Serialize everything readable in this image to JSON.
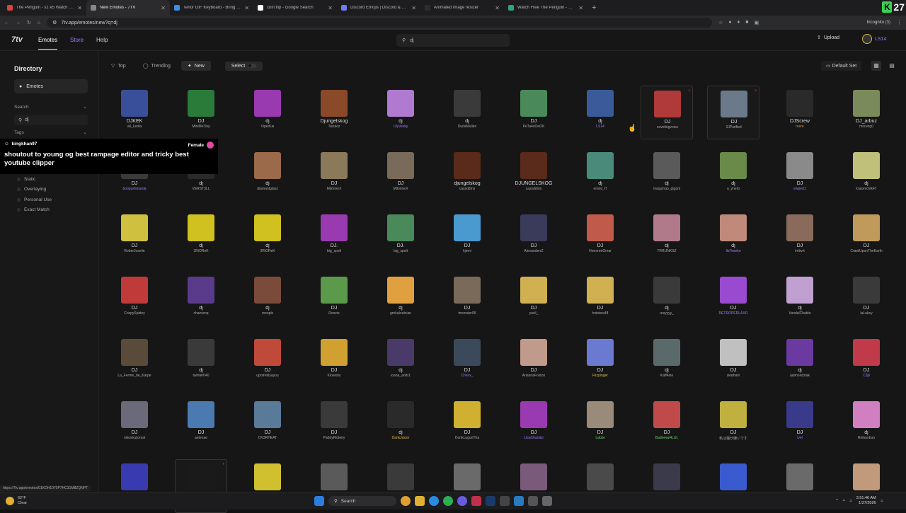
{
  "browser": {
    "tabs": [
      {
        "title": "The Penguin - s1 e5 Watch Fre",
        "color": "#d6463f",
        "active": false
      },
      {
        "title": "New Emotes - 7TV",
        "color": "#888888",
        "active": true
      },
      {
        "title": "Tenor GIF Keyboard - Bring Per",
        "color": "#3a8ee6",
        "active": false
      },
      {
        "title": "coin flip - Google Search",
        "color": "#ffffff",
        "active": false
      },
      {
        "title": "Discord Emojis | Discord & Slac",
        "color": "#6f7cf3",
        "active": false
      },
      {
        "title": "Animated image resizer",
        "color": "#2d2d2d",
        "active": false
      },
      {
        "title": "Watch Free The Penguin - Seas",
        "color": "#2fa37a",
        "active": false
      }
    ],
    "new_tab": "+",
    "url": "7tv.app/emotes/new?q=dj",
    "incognito": "Incognito (3)",
    "kick_count": "27",
    "kick_letter": "K",
    "status_url": "https://7tv.app/emotes/01KDH1070P7HC31M8ZQNPT"
  },
  "nav": {
    "logo": "7tv",
    "emotes": "Emotes",
    "store": "Store",
    "help": "Help",
    "search_value": "dj",
    "upload": "Upload",
    "username": "LS14"
  },
  "sidebar": {
    "title": "Directory",
    "emotes": "Emotes",
    "search_label": "Search",
    "search_value": "dj",
    "tags_label": "Tags",
    "filters": [
      "Static",
      "Overlaying",
      "Personal Use",
      "Exact Match"
    ]
  },
  "toolbar": {
    "top": "Top",
    "trending": "Trending",
    "new": "New",
    "select": "Select",
    "default_set": "Default Set"
  },
  "toast": {
    "user": "kingkhan97",
    "gender": "Female",
    "message": "shoutout to young og best rampage editor and tricky best youtube clipper"
  },
  "emotes": [
    [
      {
        "n": "DJKEK",
        "o": "a6_lunita",
        "c": "#3a4f9a"
      },
      {
        "n": "DJ",
        "o": "MiniMeTiny",
        "c": "#2a7a3a"
      },
      {
        "n": "dj",
        "o": "ViperKai",
        "c": "#9a3ab0"
      },
      {
        "n": "Djungelskog",
        "o": "Tazukiz",
        "c": "#8a4a2a"
      },
      {
        "n": "dj",
        "o": "LilyVesky",
        "oc": "p",
        "c": "#b07ad0"
      },
      {
        "n": "dj",
        "o": "DudaMullen",
        "c": "#3a3a3a"
      },
      {
        "n": "DJ",
        "o": "PeTa4oOeOK",
        "c": "#4a8a5a"
      },
      {
        "n": "dj",
        "o": "LS14",
        "oc": "p",
        "c": "#3a5a9a"
      },
      {
        "n": "DJ",
        "o": "covetingvoice",
        "c": "#b03a3a",
        "b": true
      },
      {
        "n": "DJ",
        "o": "ElPurified",
        "c": "#6a7a8a",
        "b": true
      },
      {
        "n": "DJScrew",
        "o": "roxre",
        "oc": "o",
        "c": "#2a2a2a"
      },
      {
        "n": "DJ_arbuz",
        "o": "morung0",
        "c": "#7a8a5a"
      }
    ],
    [
      {
        "n": "DJ",
        "o": "boopyshmurda",
        "oc": "p",
        "c": "#3a3a3a"
      },
      {
        "n": "dj",
        "o": "VERST3LL",
        "c": "#2a2a2a"
      },
      {
        "n": "dj",
        "o": "diamantglass",
        "c": "#9a6a4a"
      },
      {
        "n": "DJ",
        "o": "MilonneX",
        "c": "#8a7a5a"
      },
      {
        "n": "DJ",
        "o": "MilonneX",
        "c": "#7a6a5a"
      },
      {
        "n": "djungelskog",
        "o": "cassddms",
        "c": "#5a2a1a"
      },
      {
        "n": "DJUNGELSKOG",
        "o": "cassddms",
        "c": "#5a2a1a"
      },
      {
        "n": "dj",
        "o": "emire_H",
        "c": "#4a8a7a"
      },
      {
        "n": "dj",
        "o": "maquinao_gigant",
        "c": "#5a5a5a"
      },
      {
        "n": "dj",
        "o": "o_ynerb",
        "c": "#6a8a4a"
      },
      {
        "n": "DJ",
        "o": "ewpert1",
        "oc": "p",
        "c": "#8a8a8a"
      },
      {
        "n": "dj",
        "o": "krasevchik47",
        "c": "#c0c07a"
      }
    ],
    [
      {
        "n": "DJ",
        "o": "RoberJoselin",
        "c": "#d0c040"
      },
      {
        "n": "dj",
        "o": "3RiOReK",
        "c": "#d0c020"
      },
      {
        "n": "dj",
        "o": "3RiOReK",
        "c": "#d0c020"
      },
      {
        "n": "DJ.",
        "o": "big_spolt",
        "c": "#9a3ab0"
      },
      {
        "n": "DJ.",
        "o": "big_spolt",
        "c": "#4a8a5a"
      },
      {
        "n": "DJ",
        "o": "kjemi",
        "c": "#4a9ad0"
      },
      {
        "n": "DJ",
        "o": "AlexanderrZ",
        "c": "#3a3a5a"
      },
      {
        "n": "DJ",
        "o": "HonoredOmar",
        "c": "#c05a4a"
      },
      {
        "n": "dj",
        "o": "TRRUNKSZ",
        "c": "#b07a8a"
      },
      {
        "n": "dj",
        "o": "ItzTeseko",
        "oc": "p",
        "c": "#c08a7a"
      },
      {
        "n": "DJ",
        "o": "imbvrt",
        "c": "#8a6a5a"
      },
      {
        "n": "DJ",
        "o": "CrawlUponTheEarth",
        "c": "#c09a5a"
      }
    ],
    [
      {
        "n": "DJ",
        "o": "CrispySpidey",
        "c": "#c03a3a"
      },
      {
        "n": "dj",
        "o": "chazzzop",
        "c": "#5a3a8a"
      },
      {
        "n": "dj",
        "o": "roxopls",
        "c": "#7a4a3a"
      },
      {
        "n": "DJ",
        "o": "Roozie",
        "c": "#5a9a4a"
      },
      {
        "n": "dj",
        "o": "grekukralnian",
        "c": "#e0a040"
      },
      {
        "n": "DJ",
        "o": "tmonster95",
        "c": "#7a6a5a"
      },
      {
        "n": "DJ",
        "o": "yavil_",
        "c": "#d0b050"
      },
      {
        "n": "DJ",
        "o": "hotstew48",
        "c": "#d0b050"
      },
      {
        "n": "dj",
        "o": "rexyyyy_",
        "c": "#3a3a3a"
      },
      {
        "n": "DJ",
        "o": "RETROPERLAXO",
        "oc": "p",
        "c": "#9a4ad0"
      },
      {
        "n": "dj",
        "o": "VandalChatito",
        "c": "#c0a0d0"
      },
      {
        "n": "DJ",
        "o": "laLakey",
        "c": "#3a3a3a"
      }
    ],
    [
      {
        "n": "DJ",
        "o": "La_Ferme_de_Karpe",
        "c": "#5a4a3a"
      },
      {
        "n": "dj",
        "o": "twinter040",
        "c": "#3a3a3a"
      },
      {
        "n": "DJ",
        "o": "upotreblyayou",
        "c": "#c04a3a"
      },
      {
        "n": "DJ",
        "o": "Kloveslu",
        "c": "#d0a030"
      },
      {
        "n": "dj",
        "o": "ioana_andr1",
        "c": "#4a3a6a"
      },
      {
        "n": "DJ",
        "o": "Chevx_",
        "oc": "p",
        "c": "#3a4a5a"
      },
      {
        "n": "DJ",
        "o": "AriannaFoxton",
        "c": "#c09a8a"
      },
      {
        "n": "DJ",
        "o": "Fitzpinger",
        "oc": "y",
        "c": "#6a7ad0"
      },
      {
        "n": "dj",
        "o": "Kaff4ine",
        "c": "#5a6a6a"
      },
      {
        "n": "DJ",
        "o": "skathain",
        "c": "#c0c0c0"
      },
      {
        "n": "dj",
        "o": "aalmondziak",
        "c": "#6a3aa0"
      },
      {
        "n": "DJ",
        "o": "C3jii",
        "oc": "p",
        "c": "#c03a4a"
      }
    ],
    [
      {
        "n": "DJ",
        "o": "nikostozjomal",
        "c": "#6a6a7a"
      },
      {
        "n": "DJ",
        "o": "aetenae",
        "c": "#4a7ab0"
      },
      {
        "n": "DJ",
        "o": "OV3RHEAT",
        "c": "#5a7a9a"
      },
      {
        "n": "DJ",
        "o": "PaddyRickery",
        "c": "#3a3a3a"
      },
      {
        "n": "dj",
        "o": "DankJuicer",
        "oc": "y",
        "c": "#2a2a2a"
      },
      {
        "n": "DJ",
        "o": "DonkLuguriTha",
        "c": "#d0b030"
      },
      {
        "n": "DJ",
        "o": "LisaChanitsi",
        "oc": "p",
        "c": "#9a3ab0"
      },
      {
        "n": "DJ",
        "o": "Latzie",
        "oc": "g",
        "c": "#9a8a7a"
      },
      {
        "n": "DJ",
        "o": "Badnewz4LUL",
        "oc": "g",
        "c": "#c04a4a"
      },
      {
        "n": "DJ",
        "o": "私は猫が嫌いです",
        "c": "#c0b040"
      },
      {
        "n": "DJ",
        "o": "ivel",
        "oc": "p",
        "c": "#3a3a8a"
      },
      {
        "n": "dj",
        "o": "Rinbunbun",
        "c": "#d080c0"
      }
    ],
    [
      {
        "n": "",
        "o": "",
        "c": "#3a3ab0"
      },
      {
        "n": "",
        "o": "",
        "c": "#1a1a1a",
        "b": true
      },
      {
        "n": "",
        "o": "",
        "c": "#d0c030"
      },
      {
        "n": "",
        "o": "",
        "c": "#5a5a5a"
      },
      {
        "n": "",
        "o": "",
        "c": "#3a3a3a"
      },
      {
        "n": "",
        "o": "",
        "c": "#6a6a6a"
      },
      {
        "n": "",
        "o": "",
        "c": "#7a5a7a"
      },
      {
        "n": "",
        "o": "",
        "c": "#4a4a4a"
      },
      {
        "n": "",
        "o": "",
        "c": "#3a3a4a"
      },
      {
        "n": "",
        "o": "",
        "c": "#3a5ad0"
      },
      {
        "n": "",
        "o": "",
        "c": "#6a6a6a"
      },
      {
        "n": "",
        "o": "",
        "c": "#c09a7a"
      }
    ]
  ],
  "taskbar": {
    "temp": "62°F",
    "weather": "Clear",
    "search": "Search",
    "time": "3:51:46 AM",
    "date": "1/27/2026"
  }
}
